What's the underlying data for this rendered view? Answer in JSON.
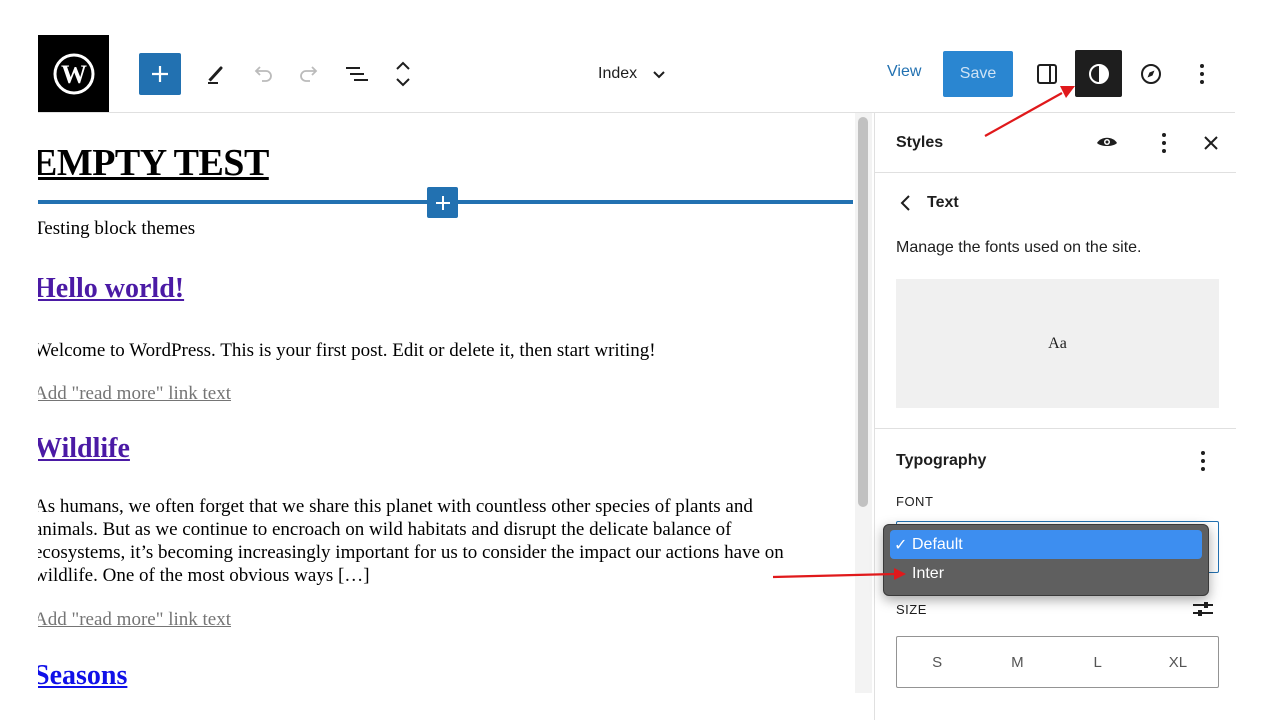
{
  "toolbar": {
    "document_title": "Index",
    "view_label": "View",
    "save_label": "Save"
  },
  "canvas": {
    "site_title": "EMPTY TEST",
    "tagline": "Testing block themes",
    "posts": [
      {
        "title": "Hello world!",
        "excerpt_lines": [
          "Welcome to WordPress. This is your first post. Edit or delete it, then start writing!"
        ],
        "read_more": "Add \"read more\" link text"
      },
      {
        "title": "Wildlife",
        "excerpt_lines": [
          "As humans, we often forget that we share this planet with countless other species of plants and",
          "animals. But as we continue to encroach on wild habitats and disrupt the delicate balance of",
          "ecosystems, it’s becoming increasingly important for us to consider the impact our actions have on",
          "wildlife. One of the most obvious ways […]"
        ],
        "read_more": "Add \"read more\" link text"
      },
      {
        "title": "Seasons"
      }
    ]
  },
  "sidebar": {
    "title": "Styles",
    "section_title": "Text",
    "description": "Manage the fonts used on the site.",
    "preview_text": "Aa",
    "typography_title": "Typography",
    "font_label": "FONT",
    "font_options": [
      "Default",
      "Inter"
    ],
    "font_selected": "Default",
    "check_mark": "✓",
    "size_label": "SIZE",
    "size_options": [
      "S",
      "M",
      "L",
      "XL"
    ]
  },
  "colors": {
    "accent": "#2271b1",
    "annotation_arrow": "#e0191b",
    "visited_link": "#4b1aa5",
    "link": "#1010e8"
  }
}
